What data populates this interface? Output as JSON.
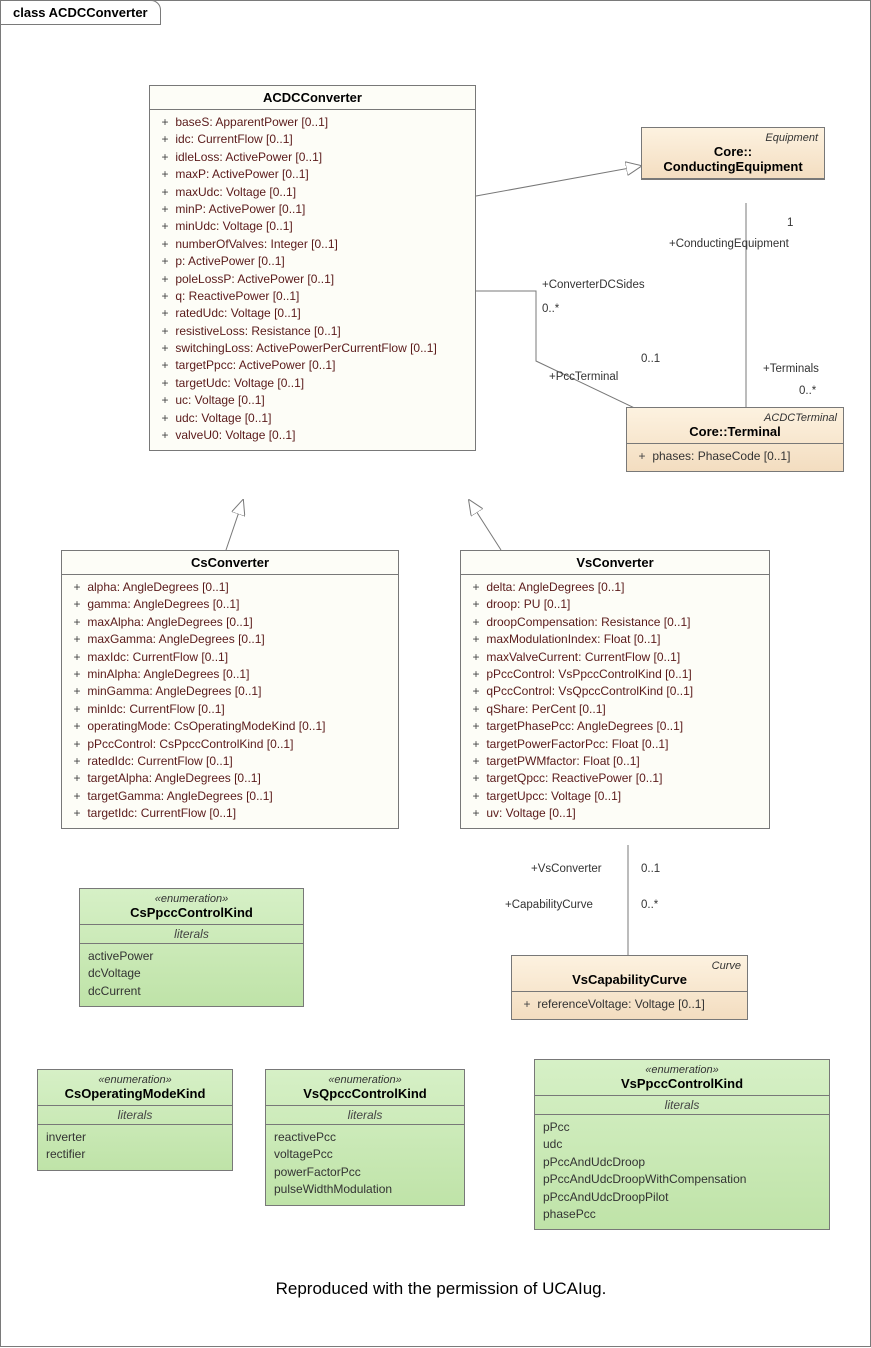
{
  "diagram_title": "class ACDCConverter",
  "caption": "Reproduced with the permission of UCAIug.",
  "classes": {
    "acdc": {
      "name": "ACDCConverter",
      "attrs": [
        "baseS: ApparentPower [0..1]",
        "idc: CurrentFlow [0..1]",
        "idleLoss: ActivePower [0..1]",
        "maxP: ActivePower [0..1]",
        "maxUdc: Voltage [0..1]",
        "minP: ActivePower [0..1]",
        "minUdc: Voltage [0..1]",
        "numberOfValves: Integer [0..1]",
        "p: ActivePower [0..1]",
        "poleLossP: ActivePower [0..1]",
        "q: ReactivePower [0..1]",
        "ratedUdc: Voltage [0..1]",
        "resistiveLoss: Resistance [0..1]",
        "switchingLoss: ActivePowerPerCurrentFlow [0..1]",
        "targetPpcc: ActivePower [0..1]",
        "targetUdc: Voltage [0..1]",
        "uc: Voltage [0..1]",
        "udc: Voltage [0..1]",
        "valveU0: Voltage [0..1]"
      ]
    },
    "cs": {
      "name": "CsConverter",
      "attrs": [
        "alpha: AngleDegrees [0..1]",
        "gamma: AngleDegrees [0..1]",
        "maxAlpha: AngleDegrees [0..1]",
        "maxGamma: AngleDegrees [0..1]",
        "maxIdc: CurrentFlow [0..1]",
        "minAlpha: AngleDegrees [0..1]",
        "minGamma: AngleDegrees [0..1]",
        "minIdc: CurrentFlow [0..1]",
        "operatingMode: CsOperatingModeKind [0..1]",
        "pPccControl: CsPpccControlKind [0..1]",
        "ratedIdc: CurrentFlow [0..1]",
        "targetAlpha: AngleDegrees [0..1]",
        "targetGamma: AngleDegrees [0..1]",
        "targetIdc: CurrentFlow [0..1]"
      ]
    },
    "vs": {
      "name": "VsConverter",
      "attrs": [
        "delta: AngleDegrees [0..1]",
        "droop: PU [0..1]",
        "droopCompensation: Resistance [0..1]",
        "maxModulationIndex: Float [0..1]",
        "maxValveCurrent: CurrentFlow [0..1]",
        "pPccControl: VsPpccControlKind [0..1]",
        "qPccControl: VsQpccControlKind [0..1]",
        "qShare: PerCent [0..1]",
        "targetPhasePcc: AngleDegrees [0..1]",
        "targetPowerFactorPcc: Float [0..1]",
        "targetPWMfactor: Float [0..1]",
        "targetQpcc: ReactivePower [0..1]",
        "targetUpcc: Voltage [0..1]",
        "uv: Voltage [0..1]"
      ]
    },
    "condEq": {
      "stereo": "Equipment",
      "name": "Core::\nConductingEquipment"
    },
    "terminal": {
      "stereo": "ACDCTerminal",
      "name": "Core::Terminal",
      "attrs": [
        "phases: PhaseCode [0..1]"
      ]
    },
    "vscap": {
      "stereo": "Curve",
      "name": "VsCapabilityCurve",
      "attrs": [
        "referenceVoltage: Voltage [0..1]"
      ]
    }
  },
  "enums": {
    "csPpcc": {
      "stereo": "«enumeration»",
      "name": "CsPpccControlKind",
      "section": "literals",
      "items": [
        "activePower",
        "dcVoltage",
        "dcCurrent"
      ]
    },
    "csOpMode": {
      "stereo": "«enumeration»",
      "name": "CsOperatingModeKind",
      "section": "literals",
      "items": [
        "inverter",
        "rectifier"
      ]
    },
    "vsQpcc": {
      "stereo": "«enumeration»",
      "name": "VsQpccControlKind",
      "section": "literals",
      "items": [
        "reactivePcc",
        "voltagePcc",
        "powerFactorPcc",
        "pulseWidthModulation"
      ]
    },
    "vsPpcc": {
      "stereo": "«enumeration»",
      "name": "VsPpccControlKind",
      "section": "literals",
      "items": [
        "pPcc",
        "udc",
        "pPccAndUdcDroop",
        "pPccAndUdcDroopWithCompensation",
        "pPccAndUdcDroopPilot",
        "phasePcc"
      ]
    }
  },
  "assoc": {
    "convDC": "+ConverterDCSides",
    "convDCm": "0..*",
    "pccT": "+PccTerminal",
    "pccTm": "0..1",
    "condEq": "+ConductingEquipment",
    "condEqm": "1",
    "terms": "+Terminals",
    "termsm": "0..*",
    "vsConv": "+VsConverter",
    "vsConvm": "0..1",
    "capC": "+CapabilityCurve",
    "capCm": "0..*"
  }
}
